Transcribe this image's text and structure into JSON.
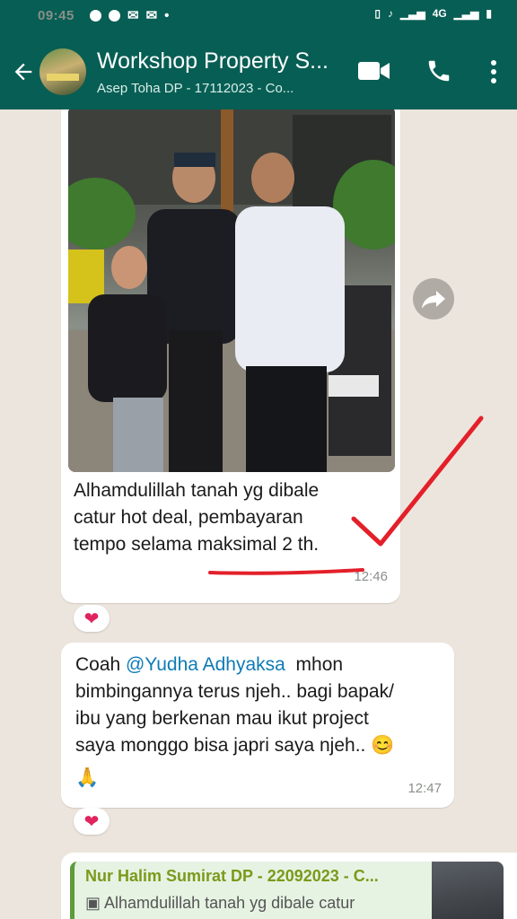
{
  "status_bar": {
    "time": "09:45",
    "right_text": "4G"
  },
  "header": {
    "title": "Workshop Property S...",
    "subtitle": "Asep Toha DP - 17112023 - Co..."
  },
  "messages": [
    {
      "type": "image",
      "caption_lines": [
        "Alhamdulillah tanah yg dibale",
        "catur hot deal, pembayaran",
        "tempo selama maksimal 2 th."
      ],
      "time": "12:46",
      "reaction": "❤"
    },
    {
      "type": "text",
      "prefix": "Coah ",
      "mention": "@Yudha Adhyaksa",
      "lines": [
        "mhon",
        "bimbingannya terus njeh.. bagi bapak/",
        "ibu yang berkenan mau ikut project",
        "saya monggo bisa japri saya njeh.."
      ],
      "emoji_smile": "😊",
      "emoji_pray": "🙏",
      "time": "12:47",
      "reaction": "❤"
    },
    {
      "type": "quote",
      "quote_author": "Nur Halim Sumirat DP - 22092023 - C...",
      "quote_text": "Alhamdulillah tanah yg dibale catur"
    }
  ],
  "colors": {
    "header": "#075E54",
    "chat_bg": "#ECE5DD",
    "mention": "#0e7bb5",
    "annotation": "#e3202a"
  }
}
